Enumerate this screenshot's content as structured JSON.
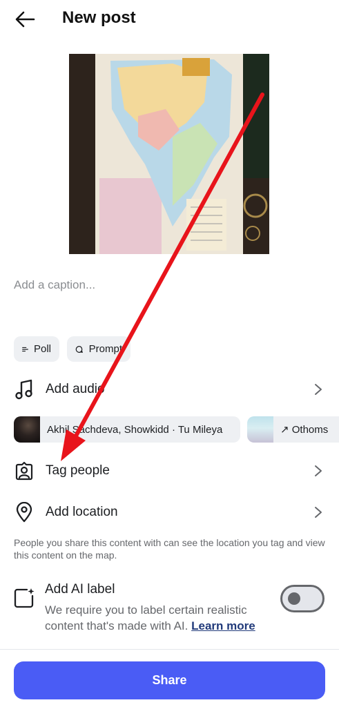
{
  "header": {
    "title": "New post"
  },
  "caption": {
    "placeholder": "Add a caption..."
  },
  "chips": {
    "poll_label": "Poll",
    "prompt_label": "Prompt"
  },
  "rows": {
    "add_audio": "Add audio",
    "tag_people": "Tag people",
    "add_location": "Add location"
  },
  "audio_suggestions": [
    {
      "text": "Akhil Sachdeva, Showkidd · Tu Mileya"
    },
    {
      "text": "↗ Othoms"
    }
  ],
  "location_note": "People you share this content with can see the location you tag and view this content on the map.",
  "ai_label": {
    "title": "Add AI label",
    "description": "We require you to label certain realistic content that's made with AI.",
    "link": "Learn more",
    "enabled": false
  },
  "share_button": "Share",
  "colors": {
    "accent": "#4a5cf5",
    "annotation": "#e8141b"
  },
  "icons": [
    "back-arrow-icon",
    "poll-icon",
    "prompt-icon",
    "music-note-icon",
    "chevron-right-icon",
    "tag-person-icon",
    "location-pin-icon",
    "ai-label-icon"
  ]
}
